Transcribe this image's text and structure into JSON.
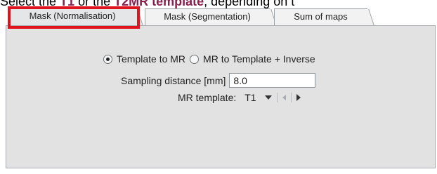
{
  "instruction": {
    "part1": "Select the ",
    "option1": "T1",
    "part2": " or the ",
    "option2": "T2MR template",
    "part3": ", depending on t"
  },
  "tabs": [
    {
      "label": "Mask (Normalisation)",
      "active": true
    },
    {
      "label": "Mask (Segmentation)",
      "active": false
    },
    {
      "label": "Sum of maps",
      "active": false
    }
  ],
  "transform": {
    "option_template_to_mr": "Template to MR",
    "option_mr_to_template": "MR to Template + Inverse",
    "selected": "Template to MR"
  },
  "sampling": {
    "label": "Sampling distance [mm]",
    "value": "8.0"
  },
  "mr_template": {
    "label": "MR template:",
    "value": "T1"
  },
  "colors": {
    "highlight": "#e0141e",
    "keyword": "#8b1f4e"
  }
}
